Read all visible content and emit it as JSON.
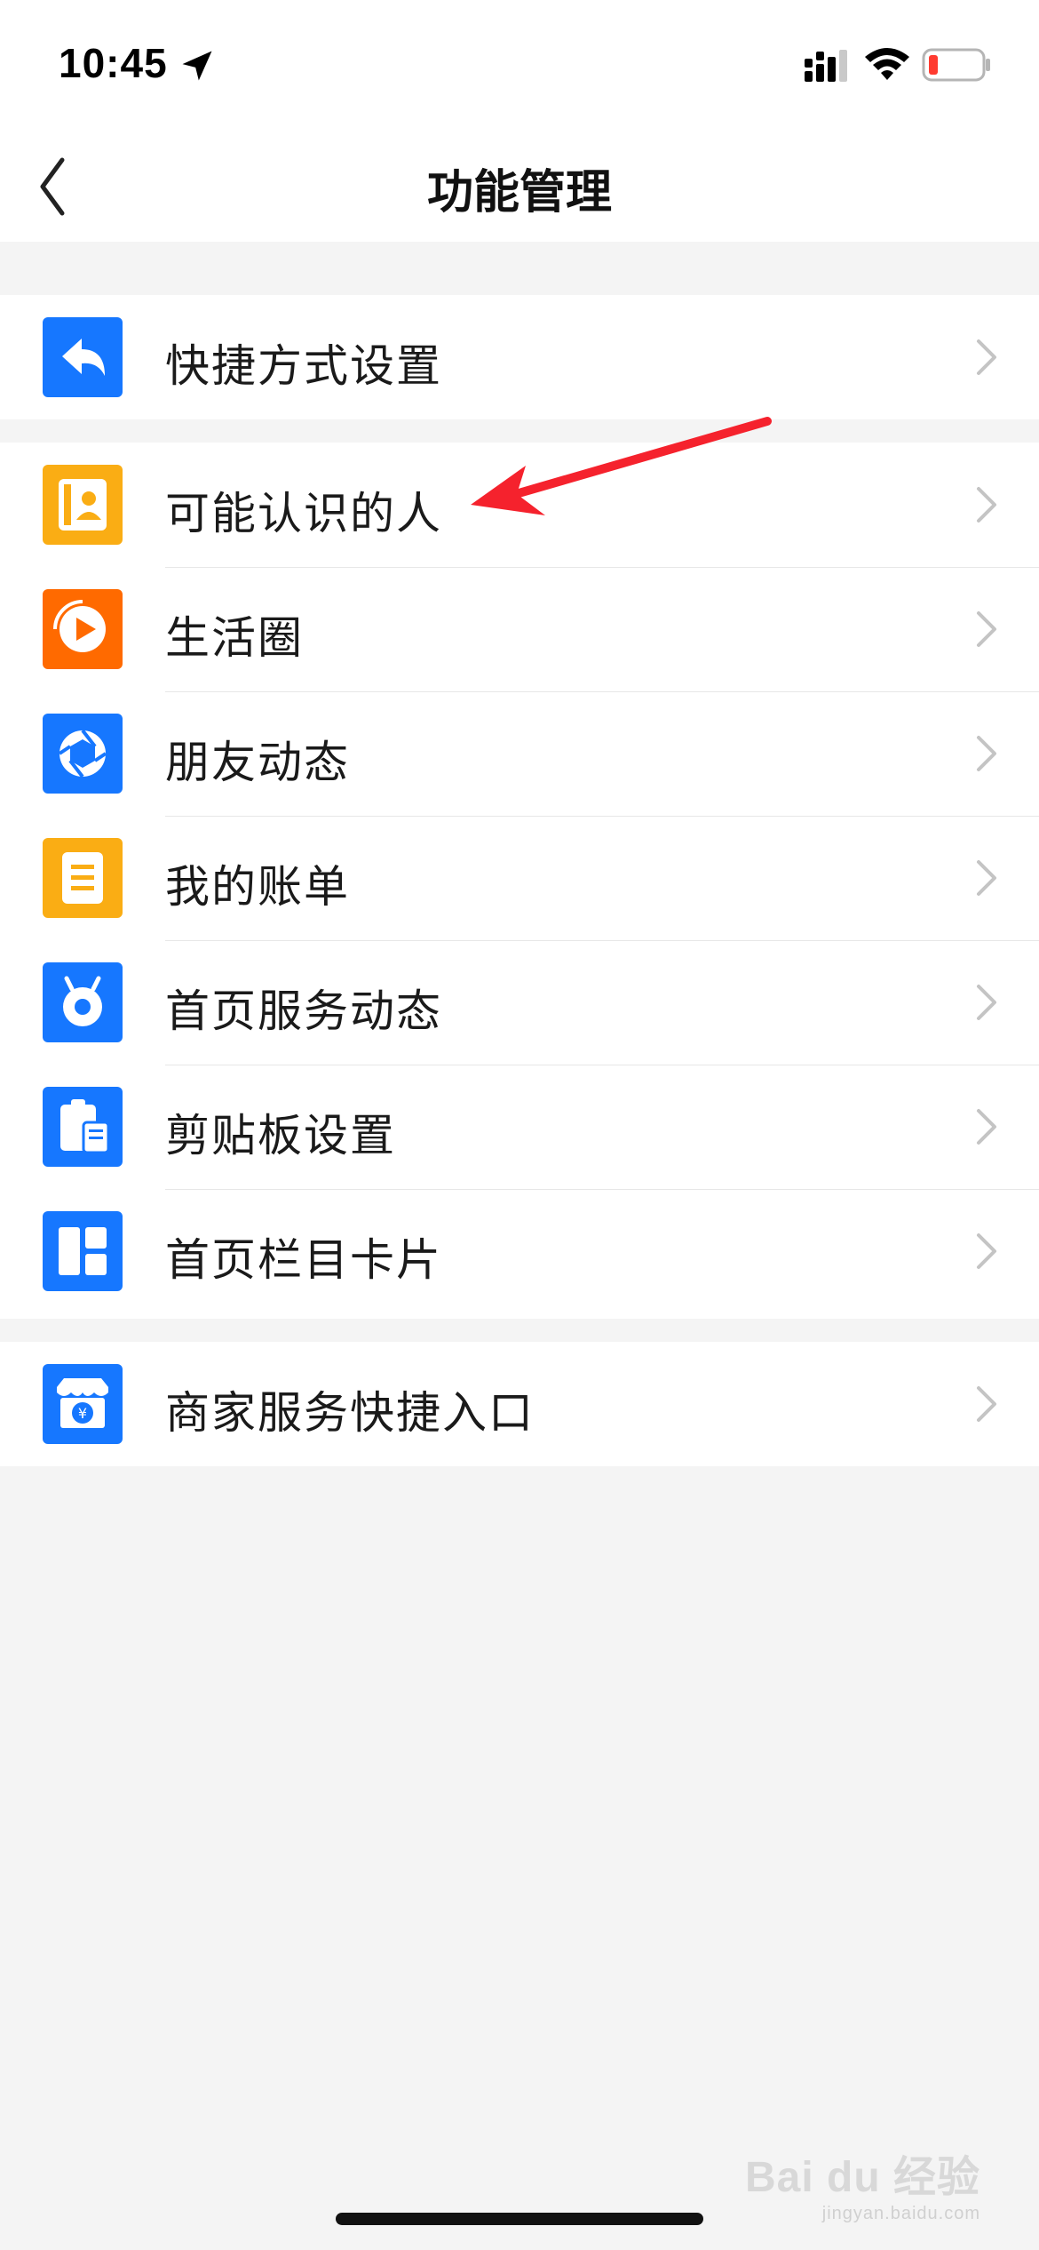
{
  "status_bar": {
    "time": "10:45",
    "location_icon": "location-arrow-icon",
    "signal_icon": "cellular-signal-icon",
    "wifi_icon": "wifi-icon",
    "battery_icon": "battery-low-icon",
    "battery_color": "#ff3b30"
  },
  "nav": {
    "title": "功能管理",
    "back_icon": "chevron-left-icon"
  },
  "groups": [
    {
      "items": [
        {
          "label": "快捷方式设置",
          "icon": "reply-arrow-icon",
          "icon_color": "#1677ff"
        }
      ]
    },
    {
      "items": [
        {
          "label": "可能认识的人",
          "icon": "contact-card-icon",
          "icon_color": "#faad14"
        },
        {
          "label": "生活圈",
          "icon": "play-circle-icon",
          "icon_color": "#ff6a00"
        },
        {
          "label": "朋友动态",
          "icon": "shutter-icon",
          "icon_color": "#1677ff"
        },
        {
          "label": "我的账单",
          "icon": "bill-icon",
          "icon_color": "#faad14"
        },
        {
          "label": "首页服务动态",
          "icon": "bug-eye-icon",
          "icon_color": "#1677ff"
        },
        {
          "label": "剪贴板设置",
          "icon": "clipboard-icon",
          "icon_color": "#1677ff"
        },
        {
          "label": "首页栏目卡片",
          "icon": "layout-cards-icon",
          "icon_color": "#1677ff"
        }
      ]
    },
    {
      "items": [
        {
          "label": "商家服务快捷入口",
          "icon": "merchant-store-icon",
          "icon_color": "#1677ff"
        }
      ]
    }
  ],
  "annotation": {
    "color": "#f5222d"
  },
  "watermark": {
    "brand": "Bai du 经验",
    "url": "jingyan.baidu.com"
  }
}
